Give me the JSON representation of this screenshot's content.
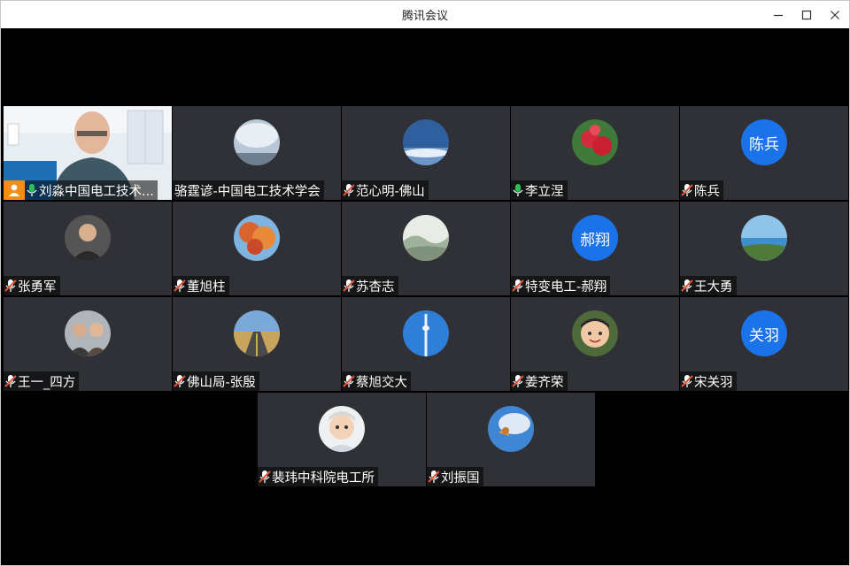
{
  "window": {
    "title": "腾讯会议"
  },
  "colors": {
    "accent": "#1a73e8",
    "mic_on": "#2fbf5a",
    "mic_off": "#e5533c",
    "host_badge": "#f08d1b"
  },
  "participants": [
    {
      "name": "刘淼中国电工技术...",
      "mic": "on",
      "avatar": "video-feed",
      "host": true
    },
    {
      "name": "骆霆谚-中国电工技术学会",
      "mic": "none",
      "avatar": "sky-photo"
    },
    {
      "name": "范心明-佛山",
      "mic": "off",
      "avatar": "blue-sky-photo"
    },
    {
      "name": "李立涅",
      "mic": "on",
      "avatar": "red-flower-photo"
    },
    {
      "name": "陈兵",
      "mic": "off",
      "avatar_text": "陈兵"
    },
    {
      "name": "张勇军",
      "mic": "off",
      "avatar": "person-photo"
    },
    {
      "name": "董旭柱",
      "mic": "off",
      "avatar": "autumn-tree-photo"
    },
    {
      "name": "苏杏志",
      "mic": "off",
      "avatar": "painting-photo"
    },
    {
      "name": "特变电工-郝翔",
      "mic": "off",
      "avatar_text": "郝翔"
    },
    {
      "name": "王大勇",
      "mic": "off",
      "avatar": "seaside-photo"
    },
    {
      "name": "王一_四方",
      "mic": "off",
      "avatar": "group-photo"
    },
    {
      "name": "佛山局-张殷",
      "mic": "off",
      "avatar": "road-photo"
    },
    {
      "name": "蔡旭交大",
      "mic": "off",
      "avatar": "tower-photo"
    },
    {
      "name": "姜齐荣",
      "mic": "off",
      "avatar": "child-photo"
    },
    {
      "name": "宋关羽",
      "mic": "off",
      "avatar_text": "关羽"
    },
    {
      "name": "裴玮中科院电工所",
      "mic": "off",
      "avatar": "baby-photo"
    },
    {
      "name": "刘振国",
      "mic": "off",
      "avatar": "sky-bird-photo"
    }
  ]
}
